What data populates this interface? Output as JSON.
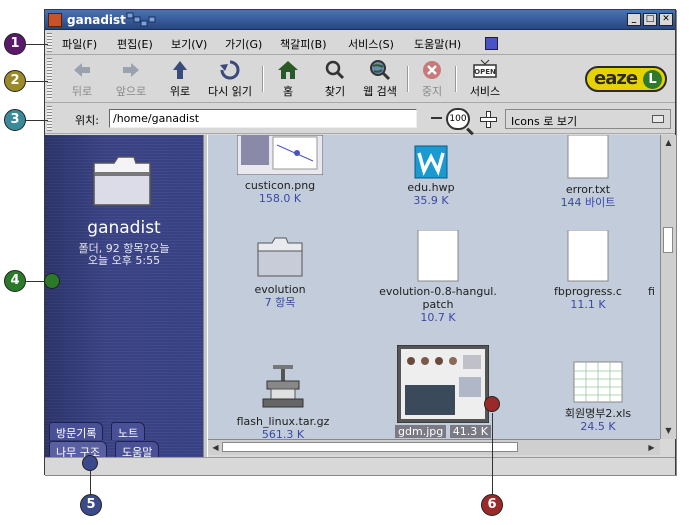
{
  "window": {
    "title": "ganadist"
  },
  "menubar": {
    "items": [
      "파일(F)",
      "편집(E)",
      "보기(V)",
      "가기(G)",
      "책갈피(B)",
      "서비스(S)",
      "도움말(H)"
    ]
  },
  "toolbar": {
    "back": "뒤로",
    "forward": "앞으로",
    "up": "위로",
    "reload": "다시 읽기",
    "home": "홈",
    "search": "찾기",
    "web_search": "웹 검색",
    "stop": "중지",
    "services": "서비스",
    "services_sign": "OPEN",
    "logo": "eaze",
    "logo_l": "L"
  },
  "location": {
    "label": "위치:",
    "value": "/home/ganadist",
    "zoom": "100",
    "view_mode": "Icons 로 보기"
  },
  "sidebar": {
    "folder_name": "ganadist",
    "info_line1": "폴더, 92 항목?오늘",
    "info_line2": "오늘 오후 5:55",
    "tabs": [
      "방문기록",
      "노트",
      "나무 구조",
      "도움말"
    ]
  },
  "files": [
    {
      "name": "custicon.png",
      "size": "158.0 K"
    },
    {
      "name": "edu.hwp",
      "size": "35.9 K"
    },
    {
      "name": "error.txt",
      "size": "144 바이트"
    },
    {
      "name": "evolution",
      "size": "7 항목"
    },
    {
      "name": "evolution-0.8-hangul.",
      "name2": "patch",
      "size": "10.7 K"
    },
    {
      "name": "fbprogress.c",
      "size": "11.1 K"
    },
    {
      "name": "fi",
      "size": ""
    },
    {
      "name": "flash_linux.tar.gz",
      "size": "561.3 K"
    },
    {
      "name": "gdm.jpg",
      "size": "41.3 K"
    },
    {
      "name": "회원명부2.xls",
      "size": "24.5 K"
    }
  ],
  "callouts": [
    "1",
    "2",
    "3",
    "4",
    "5",
    "6"
  ],
  "colors": {
    "callout1": "#5a1a6a",
    "callout2": "#9a8a2a",
    "callout3": "#3a8a9a",
    "callout4": "#2a7a2a",
    "callout5": "#3a4a8a",
    "callout6": "#9a2a2a"
  }
}
